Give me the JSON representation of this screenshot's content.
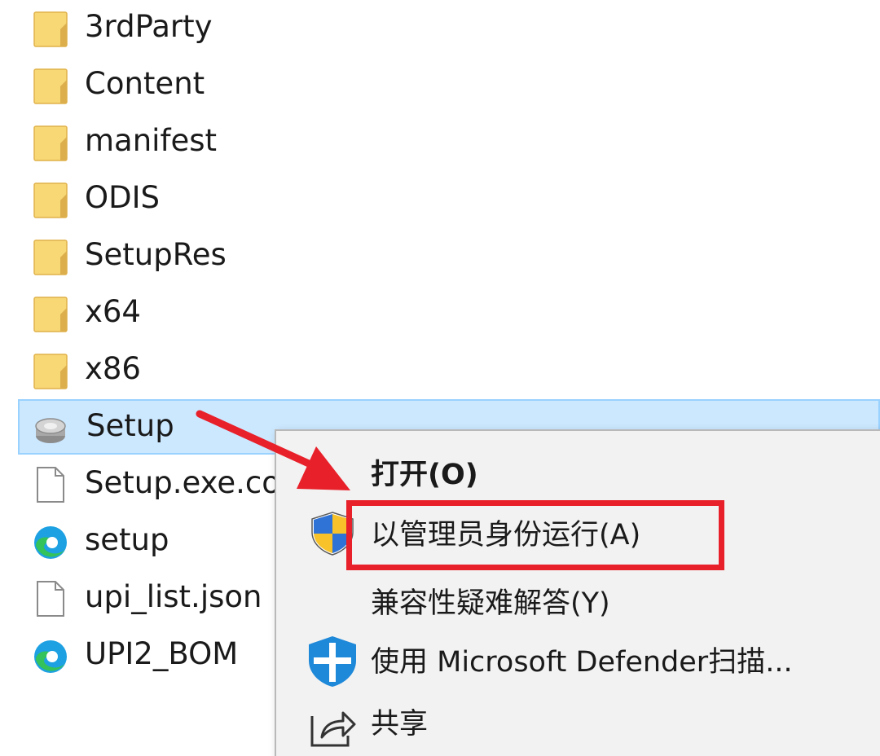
{
  "files": [
    {
      "name": "3rdParty",
      "type": "folder-icon"
    },
    {
      "name": "Content",
      "type": "folder-icon"
    },
    {
      "name": "manifest",
      "type": "folder-icon"
    },
    {
      "name": "ODIS",
      "type": "folder-icon"
    },
    {
      "name": "SetupRes",
      "type": "folder-icon"
    },
    {
      "name": "x64",
      "type": "folder-icon"
    },
    {
      "name": "x86",
      "type": "folder-icon"
    },
    {
      "name": "Setup",
      "type": "installer-icon",
      "selected": true
    },
    {
      "name": "Setup.exe.co",
      "type": "document-icon"
    },
    {
      "name": "setup",
      "type": "edge-icon"
    },
    {
      "name": "upi_list.json",
      "type": "document-icon"
    },
    {
      "name": "UPI2_BOM",
      "type": "edge-icon"
    }
  ],
  "context_menu": {
    "open": "打开(O)",
    "run_as_admin": "以管理员身份运行(A)",
    "troubleshoot_compat": "兼容性疑难解答(Y)",
    "defender_scan": "使用 Microsoft Defender扫描...",
    "share": "共享"
  },
  "icons": {
    "uac_shield": "uac-shield-icon",
    "defender": "defender-shield-icon",
    "share": "share-icon"
  },
  "colors": {
    "selection": "#cce8ff",
    "annotation_red": "#e8202a",
    "folder_yellow": "#f8d775"
  }
}
